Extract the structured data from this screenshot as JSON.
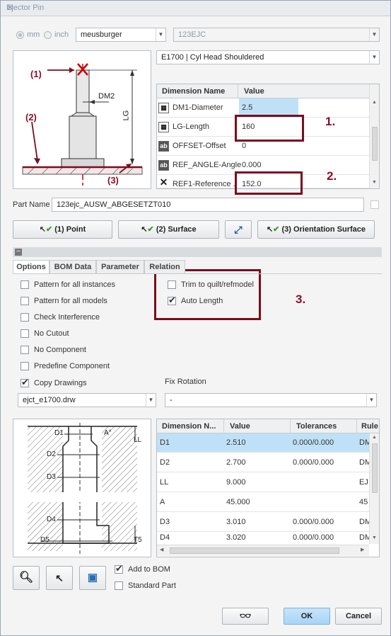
{
  "window": {
    "title": "Ejector Pin",
    "close": "✕"
  },
  "units": {
    "mm": "mm",
    "inch": "inch",
    "selected": "mm"
  },
  "supplier": {
    "value": "meusburger"
  },
  "catalog": {
    "value": "123EJC"
  },
  "type": {
    "value": "E1700 | Cyl Head Shouldered"
  },
  "top_diagram": {
    "labels": [
      "(1)",
      "(2)",
      "(3)",
      "DM2",
      "LG"
    ]
  },
  "dim_table": {
    "headers": [
      "Dimension Name",
      "Value"
    ],
    "rows": [
      {
        "icon": "table",
        "name": "DM1-Diameter",
        "value": "2.5"
      },
      {
        "icon": "table",
        "name": "LG-Length",
        "value": "160"
      },
      {
        "icon": "ab",
        "name": "OFFSET-Offset",
        "value": "0"
      },
      {
        "icon": "ab",
        "name": "REF_ANGLE-Angle",
        "value": "0.000"
      },
      {
        "icon": "x",
        "name": "REF1-Reference ...",
        "value": "152.0"
      }
    ]
  },
  "annotations": {
    "n1": "1.",
    "n2": "2.",
    "n3": "3."
  },
  "part_name": {
    "label": "Part Name",
    "value": "123ejc_AUSW_ABGESETZT010"
  },
  "placement_buttons": {
    "point": "(1) Point",
    "surface": "(2) Surface",
    "orientation": "(3) Orientation Surface"
  },
  "tabs": [
    "Options",
    "BOM Data",
    "Parameter",
    "Relation"
  ],
  "options_left": [
    {
      "label": "Pattern for all instances",
      "checked": false
    },
    {
      "label": "Pattern for all models",
      "checked": false
    },
    {
      "label": "Check Interference",
      "checked": false
    },
    {
      "label": "No Cutout",
      "checked": false
    },
    {
      "label": "No Component",
      "checked": false
    },
    {
      "label": "Predefine Component",
      "checked": false
    },
    {
      "label": "Copy Drawings",
      "checked": true
    }
  ],
  "options_right": [
    {
      "label": "Trim to quilt/refmodel",
      "checked": false
    },
    {
      "label": "Auto Length",
      "checked": true
    }
  ],
  "drawing": {
    "value": "ejct_e1700.drw"
  },
  "fix_rotation": {
    "label": "Fix Rotation",
    "value": "-"
  },
  "bottom_diagram": {
    "labels": [
      "D1",
      "A°",
      "LL",
      "D2",
      "D3",
      "D4",
      "D5",
      "T5"
    ]
  },
  "dim_table2": {
    "headers": [
      "Dimension N...",
      "Value",
      "Tolerances",
      "Rule"
    ],
    "rows": [
      {
        "name": "D1",
        "value": "2.510",
        "tol": "0.000/0.000",
        "rule": "DM"
      },
      {
        "name": "D2",
        "value": "2.700",
        "tol": "0.000/0.000",
        "rule": "DM"
      },
      {
        "name": "LL",
        "value": "9.000",
        "tol": "",
        "rule": "EJ"
      },
      {
        "name": "A",
        "value": "45.000",
        "tol": "",
        "rule": "45"
      },
      {
        "name": "D3",
        "value": "3.010",
        "tol": "0.000/0.000",
        "rule": "DM"
      },
      {
        "name": "D4",
        "value": "3.020",
        "tol": "0.000/0.000",
        "rule": "DM"
      }
    ]
  },
  "bom": {
    "add_label": "Add to BOM",
    "add_checked": true,
    "standard_label": "Standard Part",
    "standard_checked": false
  },
  "footer": {
    "ok": "OK",
    "cancel": "Cancel"
  },
  "colors": {
    "annotation": "#7a0d1e",
    "selection": "#bfe1f7",
    "ok_button": "#a9d4f5"
  }
}
